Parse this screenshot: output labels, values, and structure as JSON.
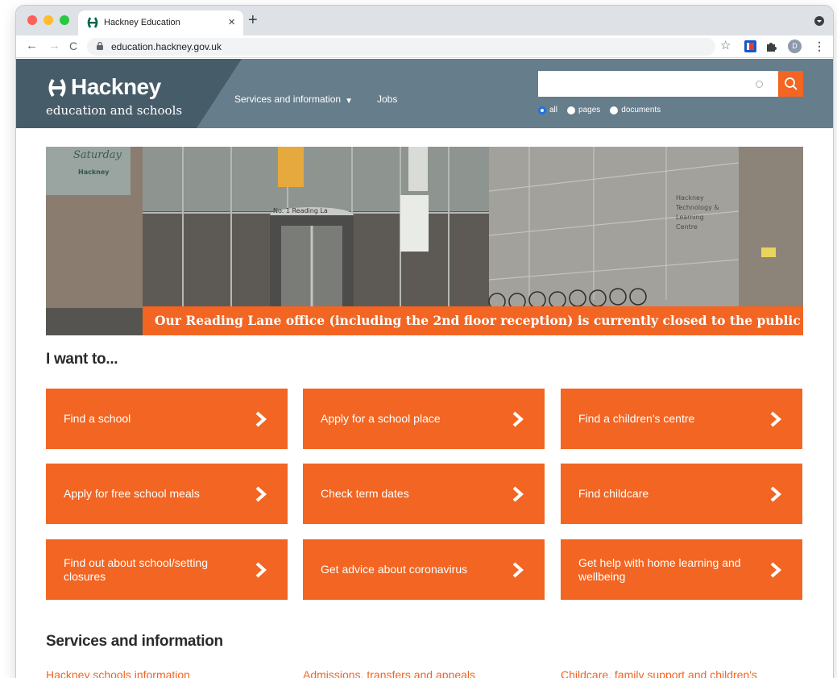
{
  "browser": {
    "tab_title": "Hackney Education",
    "tab_close": "×",
    "new_tab": "+",
    "url": "education.hackney.gov.uk",
    "profile_initial": "D",
    "icons": [
      "back-arrow-icon",
      "forward-arrow-icon",
      "reload-icon",
      "lock-icon",
      "star-icon",
      "puzzle-icon",
      "kebab-menu-icon"
    ]
  },
  "header": {
    "logo_word": "Hackney",
    "logo_subtitle": "education and schools",
    "nav": {
      "services": "Services and information",
      "jobs": "Jobs"
    },
    "search": {
      "value": "",
      "options": [
        "all",
        "pages",
        "documents"
      ],
      "selected": "all"
    }
  },
  "hero": {
    "caption": "Our Reading Lane office (including the 2nd floor reception) is currently closed to the public",
    "sign_text_1": "No. 1 Reading La",
    "sign_text_2": "Hackney",
    "sign_text_3": "Technology &",
    "sign_text_4": "Learning",
    "sign_text_5": "Centre",
    "poster_text_1": "Saturday",
    "poster_text_2": "Hackney"
  },
  "want": {
    "heading": "I want to...",
    "actions": [
      "Find a school",
      "Apply for a school place",
      "Find a children's centre",
      "Apply for free school meals",
      "Check term dates",
      "Find childcare",
      "Find out about school/setting closures",
      "Get advice about coronavirus",
      "Get help with home learning and wellbeing"
    ]
  },
  "services": {
    "heading": "Services and information",
    "links": [
      "Hackney schools information",
      "Admissions, transfers and appeals",
      "Childcare, family support and children's"
    ]
  },
  "colors": {
    "accent": "#f26522",
    "header_bg": "#667d8b",
    "logo_panel_bg": "#475c69"
  }
}
